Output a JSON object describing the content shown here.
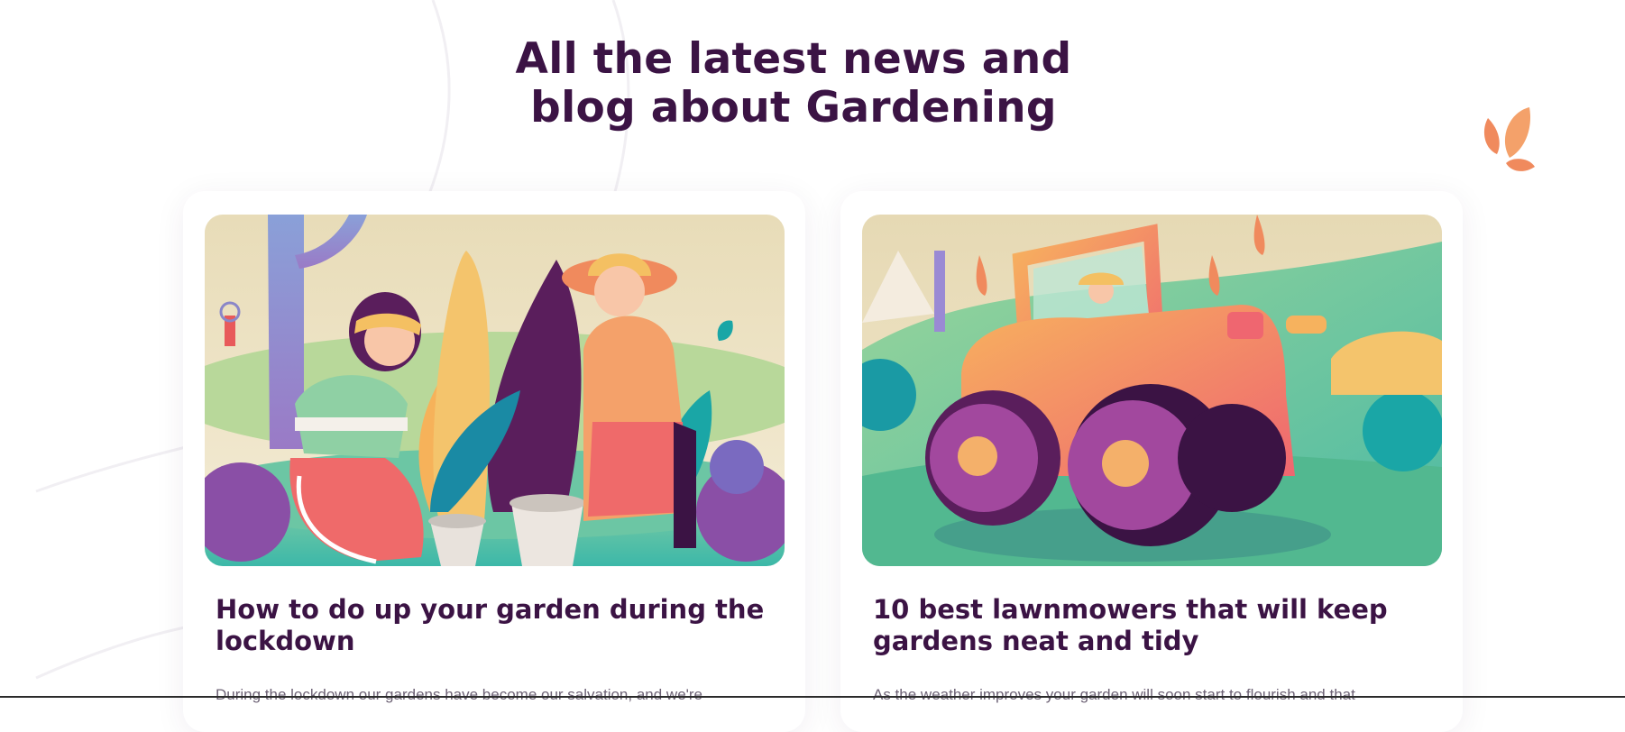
{
  "section": {
    "heading_line1": "All the latest news and",
    "heading_line2": "blog about Gardening"
  },
  "posts": [
    {
      "title": "How to do up your garden during the lockdown",
      "excerpt": "During the lockdown our gardens have become our salvation, and we're",
      "image_icon": "gardeners-planting-illustration"
    },
    {
      "title": "10 best lawnmowers that will keep gardens neat and tidy",
      "excerpt": "As the weather improves your garden will soon start to flourish and that",
      "image_icon": "tractor-illustration"
    }
  ],
  "colors": {
    "heading": "#3b1344",
    "body_text": "#6d6275",
    "accent_orange": "#f4925e",
    "accent_purple": "#5a1e5c",
    "accent_teal": "#1aa6a6"
  }
}
